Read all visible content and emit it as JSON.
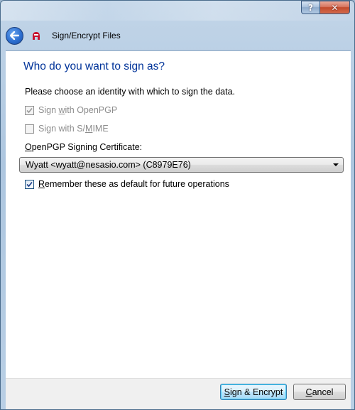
{
  "window": {
    "help_label": "?",
    "close_label": "✕"
  },
  "nav": {
    "title": "Sign/Encrypt Files",
    "back_icon": "back-arrow-icon",
    "app_icon": "kleopatra-icon"
  },
  "page": {
    "heading": "Who do you want to sign as?",
    "instruction": "Please choose an identity with which to sign the data."
  },
  "options": {
    "openpgp": {
      "label_pre": "Sign ",
      "label_u": "w",
      "label_post": "ith OpenPGP",
      "checked": true,
      "enabled": false
    },
    "smime": {
      "label_pre": "Sign with S/",
      "label_u": "M",
      "label_post": "IME",
      "checked": false,
      "enabled": false
    },
    "remember": {
      "label_pre": "",
      "label_u": "R",
      "label_post": "emember these as default for future operations",
      "checked": true,
      "enabled": true
    }
  },
  "certificate": {
    "label_pre": "",
    "label_u": "O",
    "label_post": "penPGP Signing Certificate:",
    "selected": "Wyatt <wyatt@nesasio.com> (C8979E76)"
  },
  "buttons": {
    "sign_pre": "",
    "sign_u": "S",
    "sign_post": "ign & Encrypt",
    "cancel_pre": "",
    "cancel_u": "C",
    "cancel_post": "ancel"
  }
}
